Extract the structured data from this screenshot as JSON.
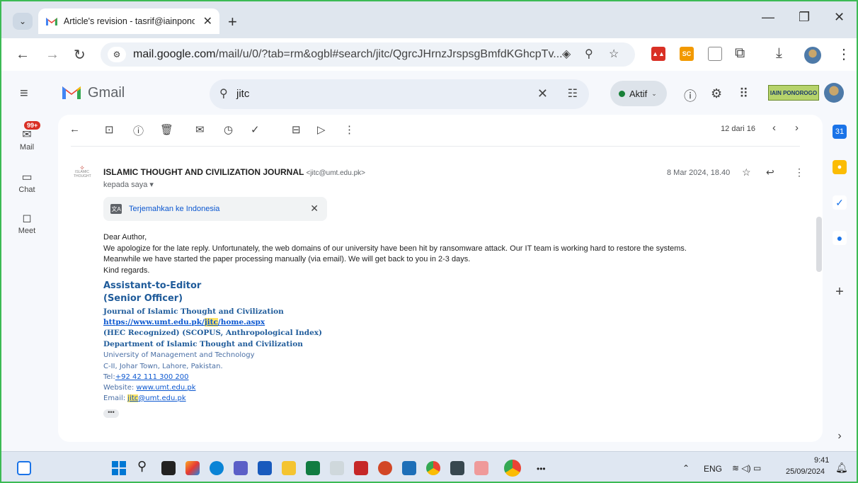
{
  "browser": {
    "tab_title": "Article's revision - tasrif@iainponorog",
    "tab_close": "✕",
    "new_tab": "+",
    "url_host": "mail.google.com",
    "url_rest": "/mail/u/0/?tab=rm&ogbl#search/jitc/QgrcJHrnzJrspsgBmfdKGhcpTv...",
    "ext_label_1": "SC"
  },
  "gmail": {
    "logo_text": "Gmail",
    "search_value": "jitc",
    "status_label": "Aktif",
    "org_logo_text": "IAIN PONOROGO",
    "nav": {
      "mail_label": "Mail",
      "mail_badge": "99+",
      "chat_label": "Chat",
      "meet_label": "Meet"
    },
    "pager": "12 dari 16"
  },
  "message": {
    "sender_name": "ISLAMIC THOUGHT AND CIVILIZATION JOURNAL",
    "sender_email": "<jitc@umt.edu.pk>",
    "recipient": "kepada saya ▾",
    "date": "8 Mar 2024, 18.40",
    "translate_label": "Terjemahkan ke Indonesia",
    "body": {
      "greeting": "Dear Author,",
      "line1": "We apologize for the late reply. Unfortunately, the web domains of our university have been hit by ransomware attack. Our IT team is working hard to restore the systems.",
      "line2": "Meanwhile we have started the paper processing manually (via email). We will get back to you in 2-3 days.",
      "closing": "Kind regards."
    },
    "signature": {
      "role1": "Assistant-to-Editor",
      "role2": "(Senior Officer)",
      "journal": "Journal of Islamic Thought and Civilization",
      "url_pre": "https://www.umt.edu.pk/",
      "url_hl": "jitc",
      "url_post": "/home.aspx",
      "recognition": "(HEC Recognized) (SCOPUS, Anthropological Index)",
      "department": "Department of Islamic Thought and Civilization",
      "university": "University of Management and Technology",
      "address": "C-II, Johar Town, Lahore, Pakistan.",
      "tel_label": "Tel:",
      "tel_value": "+92 42 111 300 200",
      "web_label": "Website: ",
      "web_value": "www.umt.edu.pk",
      "email_label": "Email: ",
      "email_hl": "jitc",
      "email_rest": "@umt.edu.pk"
    },
    "more_label": "•••"
  },
  "taskbar": {
    "lang": "ENG",
    "time": "9:41",
    "date": "25/09/2024",
    "more": "•••"
  },
  "colors": {
    "gmail_red": "#ea4335",
    "accent_blue": "#0b57d0",
    "status_green": "#188038",
    "signature_blue": "#1f5b9a",
    "highlight": "#fce365"
  }
}
